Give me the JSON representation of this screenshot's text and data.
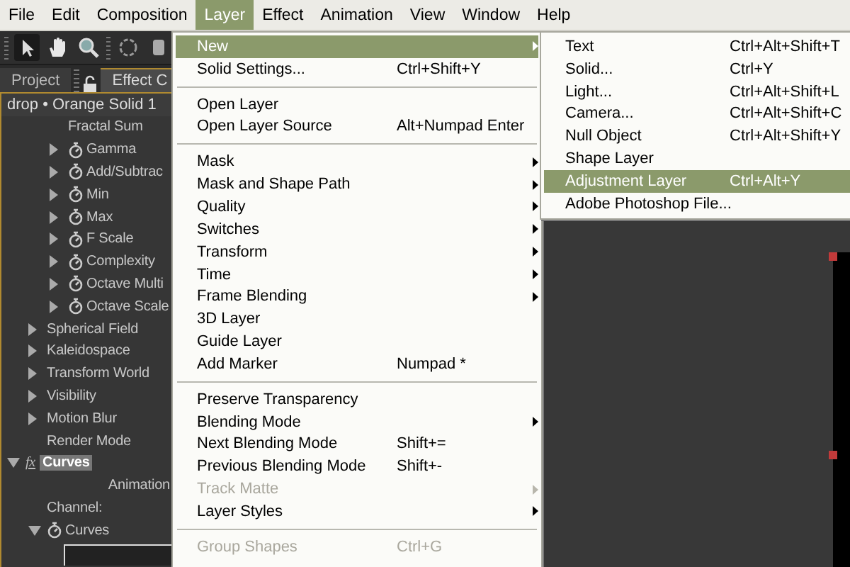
{
  "menubar": [
    {
      "label": "File",
      "selected": false
    },
    {
      "label": "Edit",
      "selected": false
    },
    {
      "label": "Composition",
      "selected": false
    },
    {
      "label": "Layer",
      "selected": true
    },
    {
      "label": "Effect",
      "selected": false
    },
    {
      "label": "Animation",
      "selected": false
    },
    {
      "label": "View",
      "selected": false
    },
    {
      "label": "Window",
      "selected": false
    },
    {
      "label": "Help",
      "selected": false
    }
  ],
  "panel_tabs": [
    {
      "label": "Project",
      "selected": false
    },
    {
      "label": "Effect C",
      "selected": true
    }
  ],
  "panel_header": "drop • Orange Solid 1",
  "tree": [
    {
      "kind": "effect",
      "children": [
        {
          "kind": "group",
          "children": [
            {
              "kind": "static",
              "label": "Fractal Sum"
            },
            {
              "kind": "param",
              "label": "Gamma",
              "expanded": false
            },
            {
              "kind": "param",
              "label": "Add/Subtrac",
              "expanded": false
            },
            {
              "kind": "param",
              "label": "Min",
              "expanded": false
            },
            {
              "kind": "param",
              "label": "Max",
              "expanded": false
            },
            {
              "kind": "param",
              "label": "F Scale",
              "expanded": false
            },
            {
              "kind": "param",
              "label": "Complexity",
              "expanded": false
            },
            {
              "kind": "param",
              "label": "Octave Multi",
              "expanded": false
            },
            {
              "kind": "param",
              "label": "Octave Scale",
              "expanded": false
            }
          ]
        },
        {
          "kind": "group",
          "label": "Spherical Field",
          "expanded": false
        },
        {
          "kind": "group",
          "label": "Kaleidospace",
          "expanded": false
        },
        {
          "kind": "group",
          "label": "Transform World",
          "expanded": false
        },
        {
          "kind": "group",
          "label": "Visibility",
          "expanded": false
        },
        {
          "kind": "group",
          "label": "Motion Blur",
          "expanded": false
        },
        {
          "kind": "static",
          "label": "Render Mode"
        }
      ]
    },
    {
      "kind": "effect",
      "fx": "fx",
      "label": "Curves",
      "selected": true,
      "expanded": true,
      "children": [
        {
          "kind": "preset",
          "label": "Animation"
        },
        {
          "kind": "static",
          "label": "Channel:"
        },
        {
          "kind": "param",
          "label": "Curves",
          "expanded": true,
          "children": [
            {
              "kind": "graph"
            }
          ]
        }
      ]
    }
  ],
  "layer_menu": [
    {
      "kind": "item",
      "label": "New",
      "submenu": true,
      "selected": true,
      "disabled": false
    },
    {
      "kind": "item",
      "label": "Solid Settings...",
      "shortcut": "Ctrl+Shift+Y",
      "submenu": false,
      "selected": false,
      "disabled": false
    },
    {
      "kind": "separator"
    },
    {
      "kind": "item",
      "label": "Open Layer",
      "submenu": false,
      "selected": false,
      "disabled": false
    },
    {
      "kind": "item",
      "label": "Open Layer Source",
      "shortcut": "Alt+Numpad Enter",
      "submenu": false,
      "selected": false,
      "disabled": false
    },
    {
      "kind": "separator"
    },
    {
      "kind": "item",
      "label": "Mask",
      "submenu": true,
      "selected": false,
      "disabled": false
    },
    {
      "kind": "item",
      "label": "Mask and Shape Path",
      "submenu": true,
      "selected": false,
      "disabled": false
    },
    {
      "kind": "item",
      "label": "Quality",
      "submenu": true,
      "selected": false,
      "disabled": false
    },
    {
      "kind": "item",
      "label": "Switches",
      "submenu": true,
      "selected": false,
      "disabled": false
    },
    {
      "kind": "item",
      "label": "Transform",
      "submenu": true,
      "selected": false,
      "disabled": false
    },
    {
      "kind": "item",
      "label": "Time",
      "submenu": true,
      "selected": false,
      "disabled": false
    },
    {
      "kind": "item",
      "label": "Frame Blending",
      "submenu": true,
      "selected": false,
      "disabled": false
    },
    {
      "kind": "item",
      "label": "3D Layer",
      "submenu": false,
      "selected": false,
      "disabled": false
    },
    {
      "kind": "item",
      "label": "Guide Layer",
      "submenu": false,
      "selected": false,
      "disabled": false
    },
    {
      "kind": "item",
      "label": "Add Marker",
      "shortcut": "Numpad *",
      "submenu": false,
      "selected": false,
      "disabled": false
    },
    {
      "kind": "separator"
    },
    {
      "kind": "item",
      "label": "Preserve Transparency",
      "submenu": false,
      "selected": false,
      "disabled": false
    },
    {
      "kind": "item",
      "label": "Blending Mode",
      "submenu": true,
      "selected": false,
      "disabled": false
    },
    {
      "kind": "item",
      "label": "Next Blending Mode",
      "shortcut": "Shift+=",
      "submenu": false,
      "selected": false,
      "disabled": false
    },
    {
      "kind": "item",
      "label": "Previous Blending Mode",
      "shortcut": "Shift+-",
      "submenu": false,
      "selected": false,
      "disabled": false
    },
    {
      "kind": "item",
      "label": "Track Matte",
      "submenu": true,
      "selected": false,
      "disabled": true
    },
    {
      "kind": "item",
      "label": "Layer Styles",
      "submenu": true,
      "selected": false,
      "disabled": false
    },
    {
      "kind": "separator"
    },
    {
      "kind": "item",
      "label": "Group Shapes",
      "shortcut": "Ctrl+G",
      "submenu": false,
      "selected": false,
      "disabled": true
    }
  ],
  "new_submenu": [
    {
      "label": "Text",
      "shortcut": "Ctrl+Alt+Shift+T",
      "selected": false
    },
    {
      "label": "Solid...",
      "shortcut": "Ctrl+Y",
      "selected": false
    },
    {
      "label": "Light...",
      "shortcut": "Ctrl+Alt+Shift+L",
      "selected": false
    },
    {
      "label": "Camera...",
      "shortcut": "Ctrl+Alt+Shift+C",
      "selected": false
    },
    {
      "label": "Null Object",
      "shortcut": "Ctrl+Alt+Shift+Y",
      "selected": false
    },
    {
      "label": "Shape Layer",
      "selected": false
    },
    {
      "label": "Adjustment Layer",
      "shortcut": "Ctrl+Alt+Y",
      "selected": true
    },
    {
      "label": "Adobe Photoshop File...",
      "selected": false
    }
  ]
}
